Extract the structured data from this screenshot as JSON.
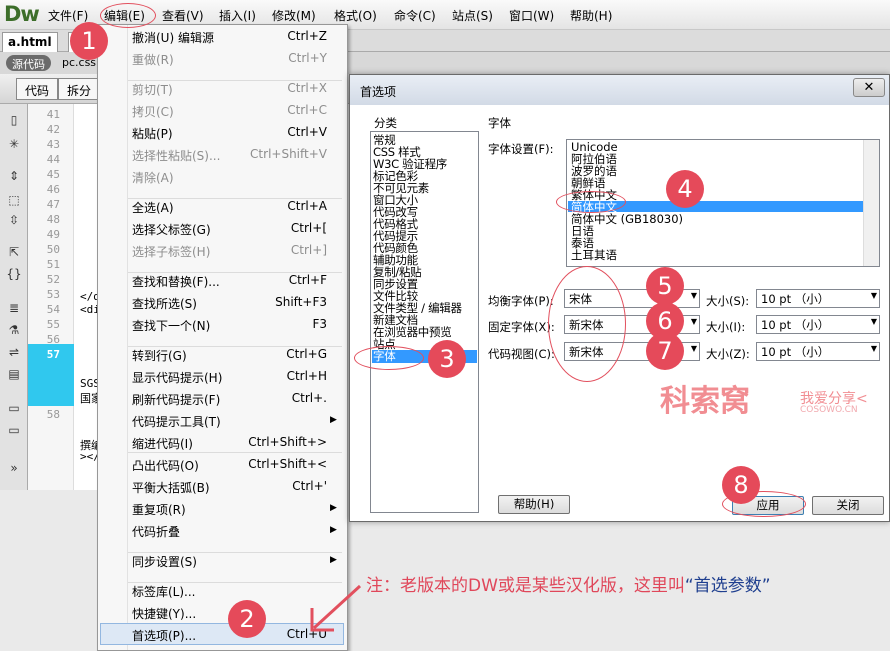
{
  "app": {
    "logo": "Dw"
  },
  "menubar": [
    "文件(F)",
    "编辑(E)",
    "查看(V)",
    "插入(I)",
    "修改(M)",
    "格式(O)",
    "命令(C)",
    "站点(S)",
    "窗口(W)",
    "帮助(H)"
  ],
  "tabs": {
    "active": "a.html",
    "second": "pc",
    "source_pill": "源代码",
    "source_file": "pc.css"
  },
  "view": {
    "code_btn": "代码",
    "split_btn": "拆分"
  },
  "line_numbers": [
    "41",
    "42",
    "43",
    "44",
    "45",
    "46",
    "47",
    "48",
    "49",
    "50",
    "51",
    "52",
    "53",
    "54",
    "55",
    "56",
    "57",
    "58"
  ],
  "code_fragments": [
    "</d",
    "<di",
    "SGS",
    "国家",
    "撰编",
    "></"
  ],
  "edit_menu": [
    {
      "label": "撤消(U) 编辑源",
      "shortcut": "Ctrl+Z",
      "disabled": false
    },
    {
      "label": "重做(R)",
      "shortcut": "Ctrl+Y",
      "disabled": true
    },
    {
      "label": "剪切(T)",
      "shortcut": "Ctrl+X",
      "disabled": true
    },
    {
      "label": "拷贝(C)",
      "shortcut": "Ctrl+C",
      "disabled": true
    },
    {
      "label": "粘贴(P)",
      "shortcut": "Ctrl+V",
      "disabled": false
    },
    {
      "label": "选择性粘贴(S)...",
      "shortcut": "Ctrl+Shift+V",
      "disabled": true
    },
    {
      "label": "清除(A)",
      "shortcut": "",
      "disabled": true
    },
    {
      "label": "全选(A)",
      "shortcut": "Ctrl+A",
      "disabled": false
    },
    {
      "label": "选择父标签(G)",
      "shortcut": "Ctrl+[",
      "disabled": false
    },
    {
      "label": "选择子标签(H)",
      "shortcut": "Ctrl+]",
      "disabled": true
    },
    {
      "label": "查找和替换(F)...",
      "shortcut": "Ctrl+F",
      "disabled": false
    },
    {
      "label": "查找所选(S)",
      "shortcut": "Shift+F3",
      "disabled": false
    },
    {
      "label": "查找下一个(N)",
      "shortcut": "F3",
      "disabled": false
    },
    {
      "label": "转到行(G)",
      "shortcut": "Ctrl+G",
      "disabled": false
    },
    {
      "label": "显示代码提示(H)",
      "shortcut": "Ctrl+H",
      "disabled": false
    },
    {
      "label": "刷新代码提示(F)",
      "shortcut": "Ctrl+.",
      "disabled": false
    },
    {
      "label": "代码提示工具(T)",
      "shortcut": "",
      "disabled": false,
      "submenu": true
    },
    {
      "label": "缩进代码(I)",
      "shortcut": "Ctrl+Shift+>",
      "disabled": false
    },
    {
      "label": "凸出代码(O)",
      "shortcut": "Ctrl+Shift+<",
      "disabled": false
    },
    {
      "label": "平衡大括弧(B)",
      "shortcut": "Ctrl+'",
      "disabled": false
    },
    {
      "label": "重复项(R)",
      "shortcut": "",
      "disabled": false,
      "submenu": true
    },
    {
      "label": "代码折叠",
      "shortcut": "",
      "disabled": false,
      "submenu": true
    },
    {
      "label": "同步设置(S)",
      "shortcut": "",
      "disabled": false,
      "submenu": true
    },
    {
      "label": "标签库(L)...",
      "shortcut": "",
      "disabled": false
    },
    {
      "label": "快捷键(Y)...",
      "shortcut": "",
      "disabled": false
    },
    {
      "label": "首选项(P)...",
      "shortcut": "Ctrl+U",
      "disabled": false
    }
  ],
  "dialog": {
    "title": "首选项",
    "close": "✕",
    "category_header": "分类",
    "section_header": "字体",
    "categories": [
      "常规",
      "CSS 样式",
      "W3C 验证程序",
      "标记色彩",
      "不可见元素",
      "窗口大小",
      "代码改写",
      "代码格式",
      "代码提示",
      "代码颜色",
      "辅助功能",
      "复制/粘贴",
      "同步设置",
      "文件比较",
      "文件类型 / 编辑器",
      "新建文档",
      "在浏览器中预览",
      "站点",
      "字体"
    ],
    "selected_category": "字体",
    "font_setting_label": "字体设置(F):",
    "font_list": [
      "Unicode",
      "阿拉伯语",
      "波罗的语",
      "朝鲜语",
      "繁体中文",
      "简体中文",
      "简体中文 (GB18030)",
      "日语",
      "泰语",
      "土耳其语"
    ],
    "selected_font": "简体中文",
    "rows": [
      {
        "label": "均衡字体(P):",
        "font": "宋体",
        "size_label": "大小(S):",
        "size": "10 pt （小）"
      },
      {
        "label": "固定字体(X):",
        "font": "新宋体",
        "size_label": "大小(I):",
        "size": "10 pt （小）"
      },
      {
        "label": "代码视图(C):",
        "font": "新宋体",
        "size_label": "大小(Z):",
        "size": "10 pt （小）"
      }
    ],
    "help_btn": "帮助(H)",
    "apply_btn": "应用",
    "close_btn": "关闭"
  },
  "annotations": {
    "steps": [
      "1",
      "2",
      "3",
      "4",
      "5",
      "6",
      "7",
      "8"
    ],
    "note_prefix": "注：老版本的DW或是某些汉化版，这里叫",
    "note_highlight": "“首选参数”",
    "watermark": "科索窝",
    "watermark_sub": "我爱分享<",
    "watermark_url": "COSOWO.CN"
  },
  "colors": {
    "badge": "#e54a5a",
    "selection": "#3399ff",
    "current_line": "#30c8ee"
  }
}
